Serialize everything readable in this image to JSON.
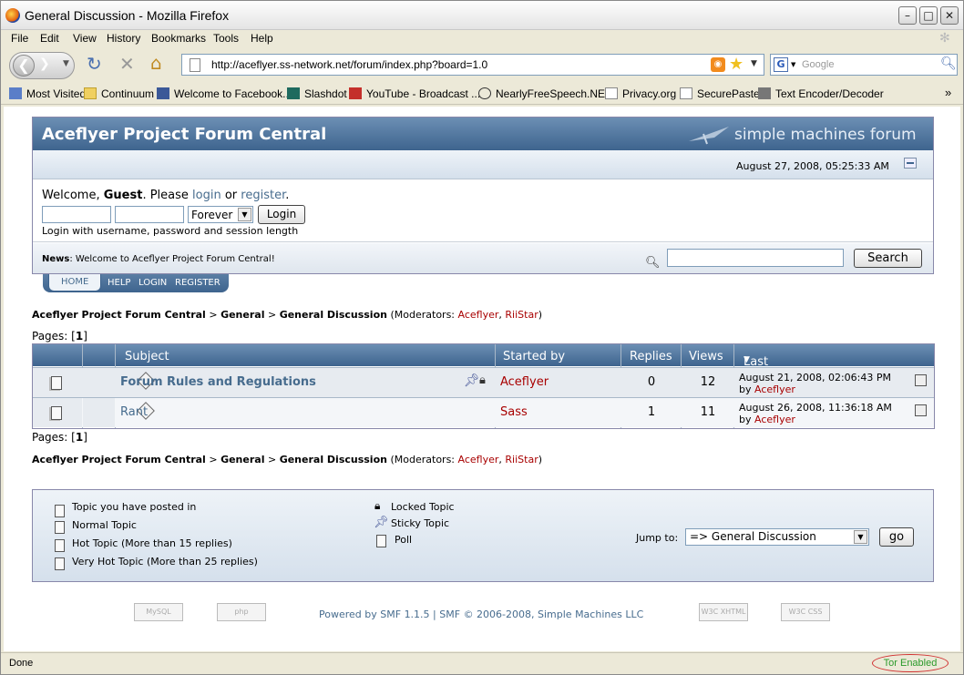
{
  "window": {
    "title": "General Discussion - Mozilla Firefox"
  },
  "menu": [
    "File",
    "Edit",
    "View",
    "History",
    "Bookmarks",
    "Tools",
    "Help"
  ],
  "address": {
    "url": "http://aceflyer.ss-network.net/forum/index.php?board=1.0"
  },
  "search": {
    "placeholder": "Google"
  },
  "bookmarks": [
    "Most Visited",
    "Continuum",
    "Welcome to Facebook...",
    "Slashdot",
    "YouTube - Broadcast ...",
    "NearlyFreeSpeech.NET",
    "Privacy.org",
    "SecurePaste",
    "Text Encoder/Decoder"
  ],
  "forum": {
    "title": "Aceflyer Project Forum Central",
    "brand": "simple machines forum",
    "datetime": "August 27, 2008, 05:25:33 AM",
    "welcome_prefix": "Welcome, ",
    "guest": "Guest",
    "welcome_mid": ". Please ",
    "login_link": "login",
    "or": " or ",
    "register_link": "register",
    "period": ".",
    "duration": "Forever",
    "login_button": "Login",
    "login_hint": "Login with username, password and session length",
    "news_label": "News",
    "news_text": ": Welcome to Aceflyer Project Forum Central!",
    "search_button": "Search"
  },
  "tabs": [
    "HOME",
    "HELP",
    "LOGIN",
    "REGISTER"
  ],
  "breadcrumb": {
    "root": "Aceflyer Project Forum Central",
    "sep": " > ",
    "cat": "General",
    "board": "General Discussion",
    "mod_prefix": " (Moderators: ",
    "mod1": "Aceflyer",
    "mod_sep": ", ",
    "mod2": "RiiStar",
    "mod_suffix": ")"
  },
  "pages": {
    "label": "Pages: [",
    "current": "1",
    "close": "]"
  },
  "table": {
    "headers": {
      "subject": "Subject",
      "started_by": "Started by",
      "replies": "Replies",
      "views": "Views",
      "last_post": "Last post"
    },
    "rows": [
      {
        "subject": "Forum Rules and Regulations",
        "starter": "Aceflyer",
        "replies": "0",
        "views": "12",
        "last_date": "August 21, 2008, 02:06:43 PM",
        "by": "by ",
        "last_by": "Aceflyer"
      },
      {
        "subject": "Rant",
        "starter": "Sass",
        "replies": "1",
        "views": "11",
        "last_date": "August 26, 2008, 11:36:18 AM",
        "by": "by ",
        "last_by": "Aceflyer"
      }
    ]
  },
  "legend": {
    "posted_in": "Topic you have posted in",
    "normal": "Normal Topic",
    "hot": "Hot Topic (More than 15 replies)",
    "very_hot": "Very Hot Topic (More than 25 replies)",
    "locked": "Locked Topic",
    "sticky": "Sticky Topic",
    "poll": "Poll",
    "jump_label": "Jump to:",
    "jump_value": "=> General Discussion",
    "go_button": "go"
  },
  "footer": {
    "powered_prefix": "Powered by ",
    "smf_version": "SMF 1.1.5",
    "divider": " | ",
    "copyright": "SMF © 2006-2008, Simple Machines LLC"
  },
  "status": {
    "text": "Done",
    "tor": "Tor Enabled"
  }
}
